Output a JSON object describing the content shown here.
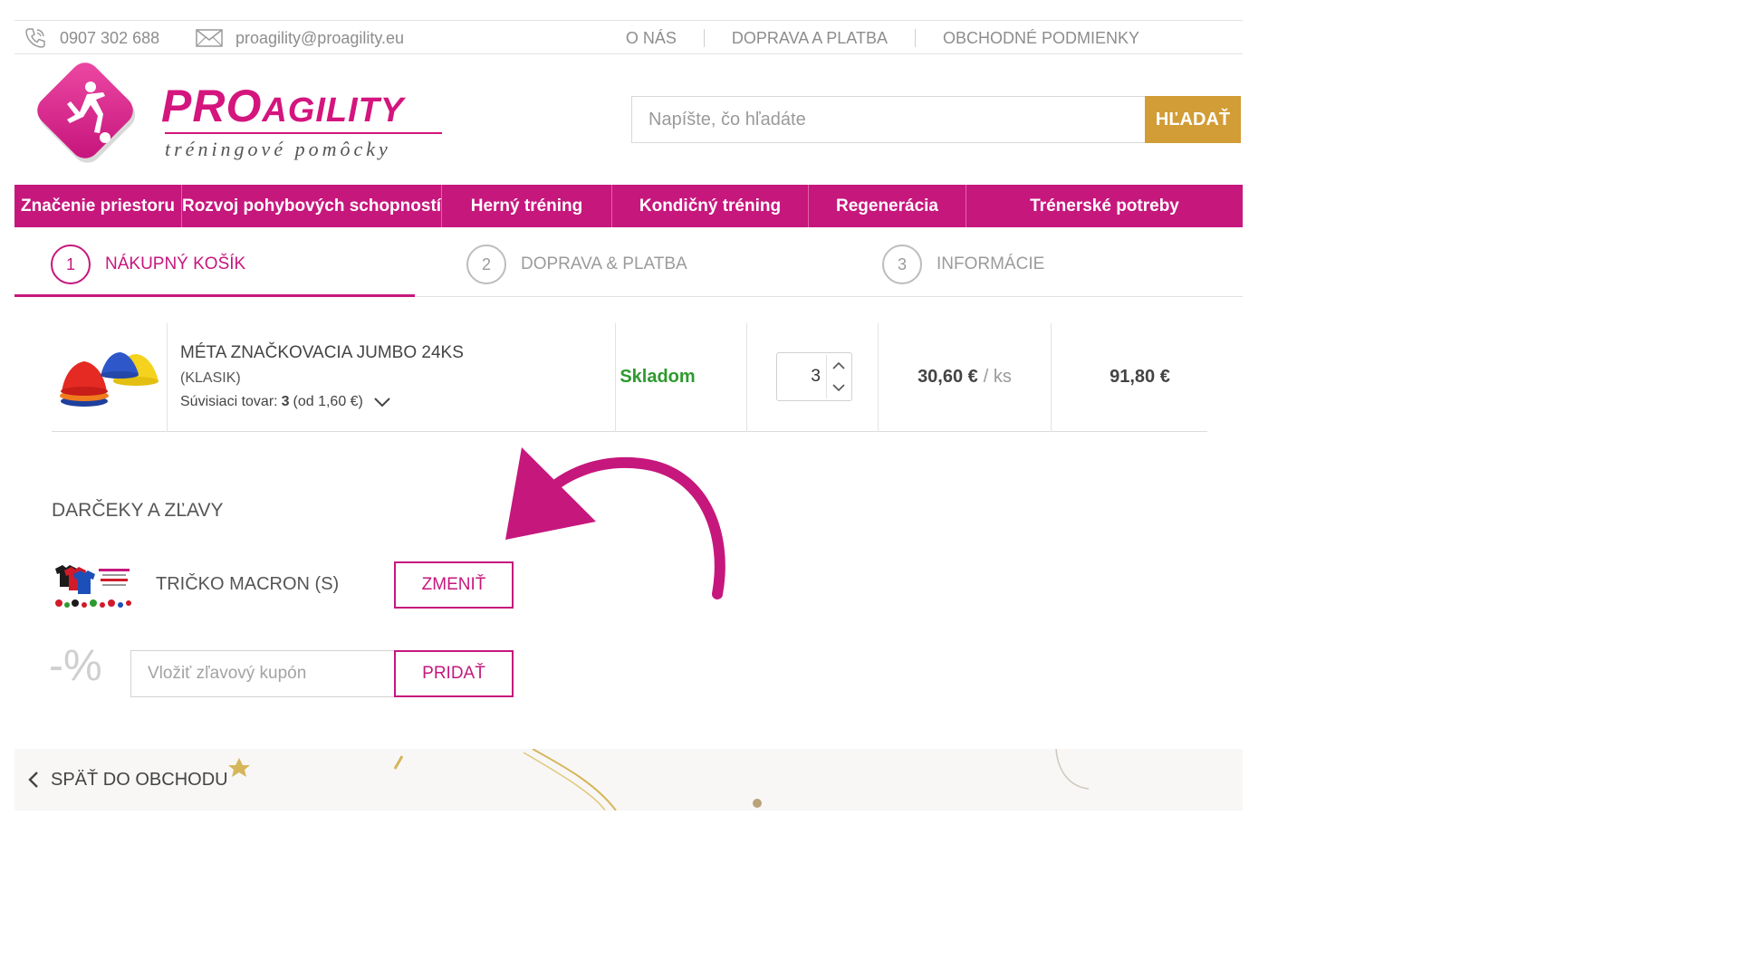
{
  "topbar": {
    "phone": "0907 302 688",
    "email": "proagility@proagility.eu",
    "links": [
      "O NÁS",
      "DOPRAVA A PLATBA",
      "OBCHODNÉ PODMIENKY"
    ]
  },
  "logo": {
    "brand_pro": "PRO",
    "brand_agility": "AGILITY",
    "tagline": "tréningové pomôcky"
  },
  "search": {
    "placeholder": "Napíšte, čo hľadáte",
    "button": "HĽADAŤ"
  },
  "mainnav": [
    "Značenie priestoru",
    "Rozvoj pohybových schopností",
    "Herný tréning",
    "Kondičný tréning",
    "Regenerácia",
    "Trénerské potreby"
  ],
  "steps": [
    {
      "num": "1",
      "label": "NÁKUPNÝ KOŠÍK"
    },
    {
      "num": "2",
      "label": "DOPRAVA & PLATBA"
    },
    {
      "num": "3",
      "label": "INFORMÁCIE"
    }
  ],
  "cart": {
    "item": {
      "name": "MÉTA ZNAČKOVACIA JUMBO 24KS",
      "variant": "(KLASIK)",
      "related_label": "Súvisiaci tovar:",
      "related_count": "3",
      "related_price": "(od 1,60 €)",
      "stock": "Skladom",
      "quantity": "3",
      "unit_price": "30,60 €",
      "unit_suffix": "/ ks",
      "total": "91,80 €"
    }
  },
  "gifts": {
    "title": "DARČEKY A ZĽAVY",
    "gift_name": "TRIČKO MACRON (S)",
    "change_button": "ZMENIŤ",
    "percent_symbol": "-%",
    "coupon_placeholder": "Vložiť zľavový kupón",
    "add_button": "PRIDAŤ"
  },
  "footer": {
    "back": "SPÄŤ DO OBCHODU"
  },
  "colors": {
    "brand": "#c6177d",
    "search_button": "#d29c36",
    "stock": "#2e9a2e"
  }
}
